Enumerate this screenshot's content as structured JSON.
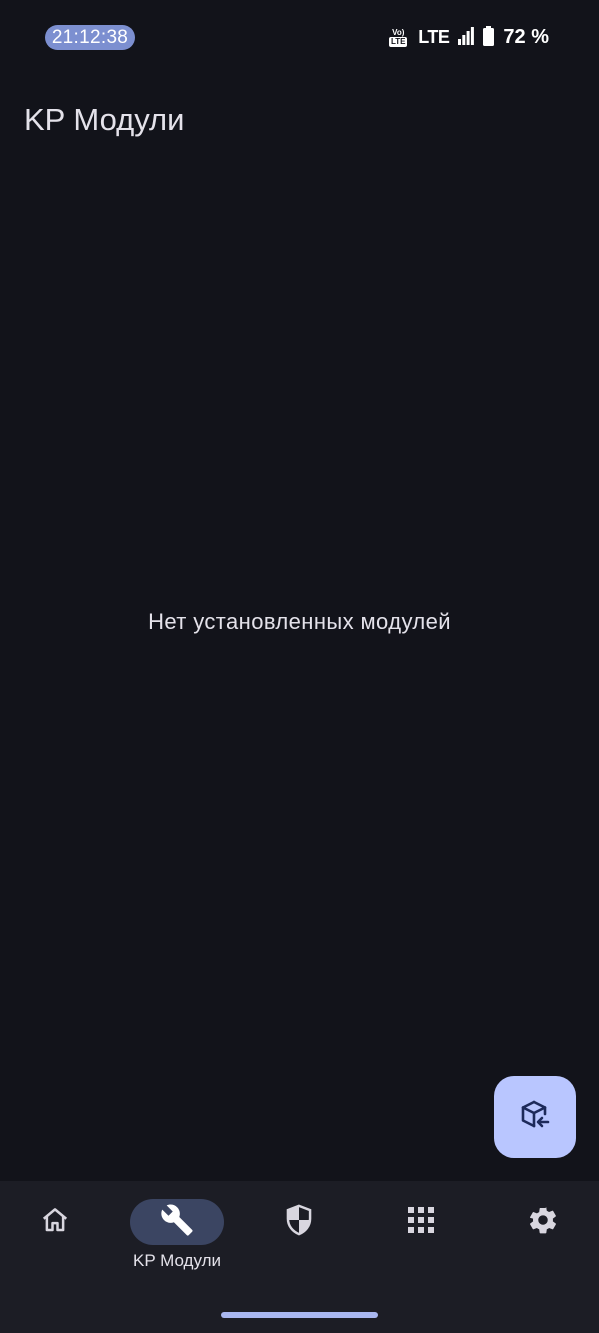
{
  "status_bar": {
    "time": "21:12:38",
    "volte_top": "Vo)",
    "volte_bottom": "LTE",
    "network": "LTE",
    "battery": "72 %",
    "icons": [
      "volte-icon",
      "signal-icon",
      "battery-icon"
    ]
  },
  "header": {
    "title": "KP Модули"
  },
  "main": {
    "empty_message": "Нет установленных модулей"
  },
  "fab": {
    "icon": "install-module-icon"
  },
  "bottom_nav": {
    "items": [
      {
        "id": "home",
        "icon": "home-icon",
        "label": "",
        "active": false
      },
      {
        "id": "modules",
        "icon": "wrench-icon",
        "label": "KP Модули",
        "active": true
      },
      {
        "id": "superuser",
        "icon": "shield-icon",
        "label": "",
        "active": false
      },
      {
        "id": "apps",
        "icon": "grid-icon",
        "label": "",
        "active": false
      },
      {
        "id": "settings",
        "icon": "gear-icon",
        "label": "",
        "active": false
      }
    ]
  },
  "colors": {
    "background": "#12131a",
    "nav_background": "#1c1d25",
    "accent": "#b9c6ff",
    "active_pill": "#3b4562",
    "clock_pill": "#7c8fd0"
  }
}
